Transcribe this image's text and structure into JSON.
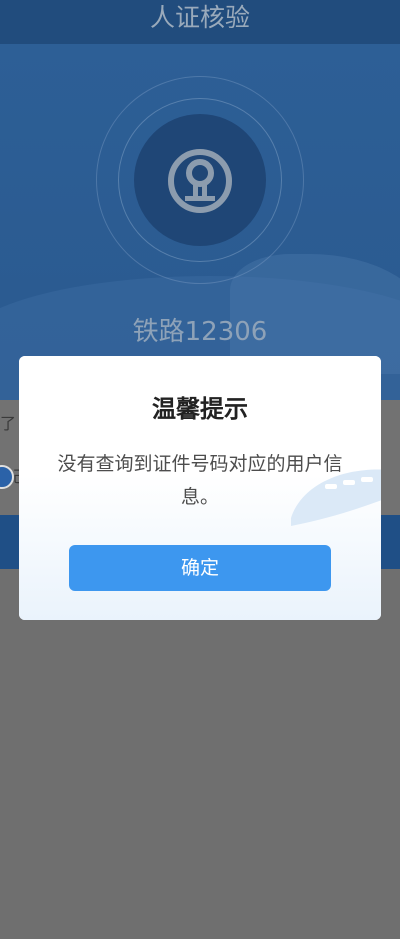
{
  "header": {
    "title": "人证核验"
  },
  "hero": {
    "brand": "铁路12306",
    "logo_icon": "railway-logo-icon"
  },
  "background_fragments": {
    "text_1": "了",
    "text_2": "己"
  },
  "dialog": {
    "title": "温馨提示",
    "message": "没有查询到证件号码对应的用户信息。",
    "confirm_label": "确定"
  },
  "colors": {
    "accent": "#3d97ef",
    "header_bg": "#214c7d",
    "overlay": "#6f6f6f"
  }
}
